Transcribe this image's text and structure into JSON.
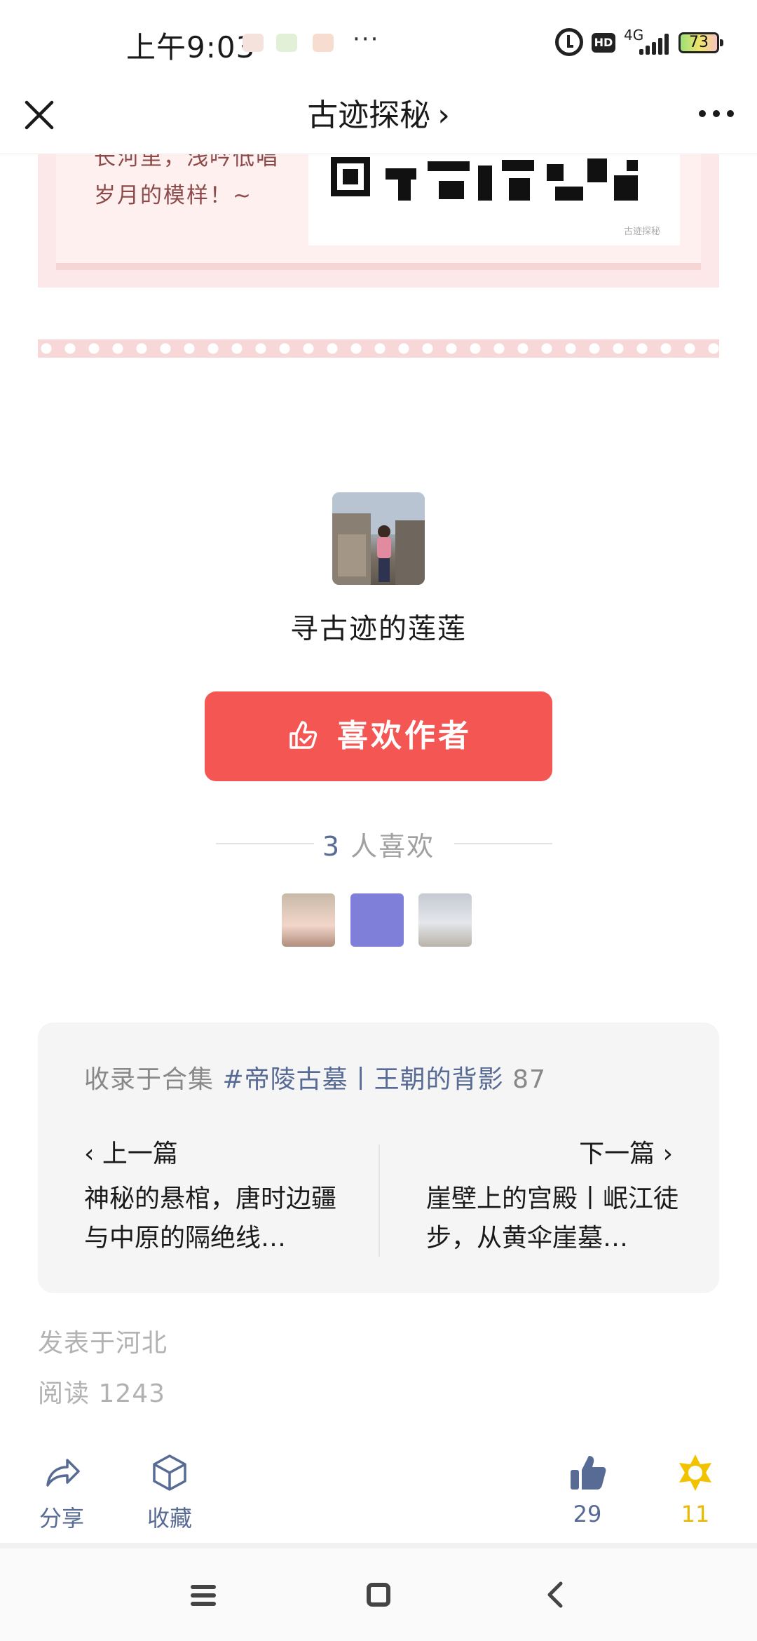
{
  "status_bar": {
    "time": "上午9:03",
    "more_dots": "···",
    "network": "4G",
    "hd": "HD",
    "battery": "73"
  },
  "nav": {
    "title": "古迹探秘",
    "title_chevron": "›",
    "close_icon": "close-icon",
    "more_icon": "more-dots-icon"
  },
  "promo": {
    "text_line1": "长河里，浅吟低唱",
    "text_line2": "岁月的模样！~",
    "qr_watermark": "古迹探秘"
  },
  "author": {
    "name": "寻古迹的莲莲",
    "like_button": "喜欢作者",
    "like_count_num": "3",
    "like_count_text": "人喜欢"
  },
  "collection": {
    "prefix": "收录于合集",
    "tag": "#帝陵古墓丨王朝的背影",
    "count": "87",
    "prev_label": "上一篇",
    "prev_title": "神秘的悬棺，唐时边疆与中原的隔绝线…",
    "next_label": "下一篇",
    "next_title": "崖壁上的宫殿丨岷江徒步，从黄伞崖墓…"
  },
  "meta": {
    "location": "发表于河北",
    "reads": "阅读 1243"
  },
  "actions": {
    "share": "分享",
    "favorite": "收藏",
    "like_count": "29",
    "wow_count": "11"
  },
  "colors": {
    "accent_red": "#f45654",
    "link_blue": "#576b95",
    "wow_yellow": "#e9b800"
  }
}
